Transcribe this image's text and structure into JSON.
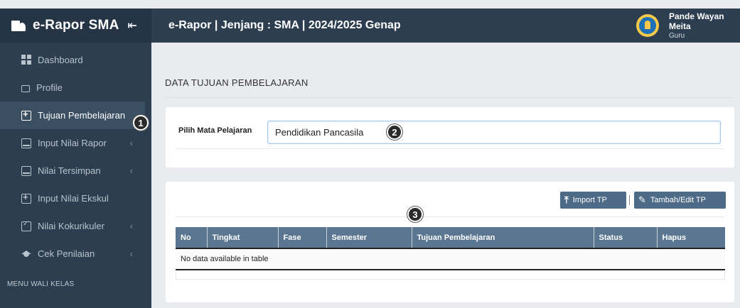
{
  "sidebar": {
    "brand_title": "e-Rapor SMA",
    "collapse_glyph": "⇤",
    "items": [
      {
        "label": "Dashboard",
        "icon": "dashboard-icon",
        "chevron": ""
      },
      {
        "label": "Profile",
        "icon": "profile-icon",
        "chevron": ""
      },
      {
        "label": "Tujuan Pembelajaran",
        "icon": "add-box-icon",
        "chevron": "",
        "active": true
      },
      {
        "label": "Input Nilai Rapor",
        "icon": "book-icon",
        "chevron": "‹"
      },
      {
        "label": "Nilai Tersimpan",
        "icon": "book-icon",
        "chevron": "‹"
      },
      {
        "label": "Input Nilai Ekskul",
        "icon": "add-box-icon",
        "chevron": ""
      },
      {
        "label": "Nilai Kokurikuler",
        "icon": "clipboard-check-icon",
        "chevron": "‹"
      },
      {
        "label": "Cek Penilaian",
        "icon": "graduation-cap-icon",
        "chevron": "‹"
      }
    ],
    "section_header": "MENU WALI KELAS"
  },
  "header": {
    "title": "e-Rapor | Jenjang : SMA | 2024/2025 Genap",
    "user_name": "Pande Wayan Meita",
    "user_role": "Guru"
  },
  "main": {
    "page_title": "DATA TUJUAN PEMBELAJARAN",
    "mapel_label": "Pilih Mata Pelajaran",
    "mapel_value": "Pendidikan Pancasila",
    "import_button": "Import TP",
    "add_edit_button": "Tambah/Edit TP",
    "table": {
      "columns": [
        "No",
        "Tingkat",
        "Fase",
        "Semester",
        "Tujuan Pembelajaran",
        "Status",
        "Hapus"
      ],
      "empty_message": "No data available in table"
    }
  },
  "callouts": [
    "1",
    "2",
    "3"
  ]
}
